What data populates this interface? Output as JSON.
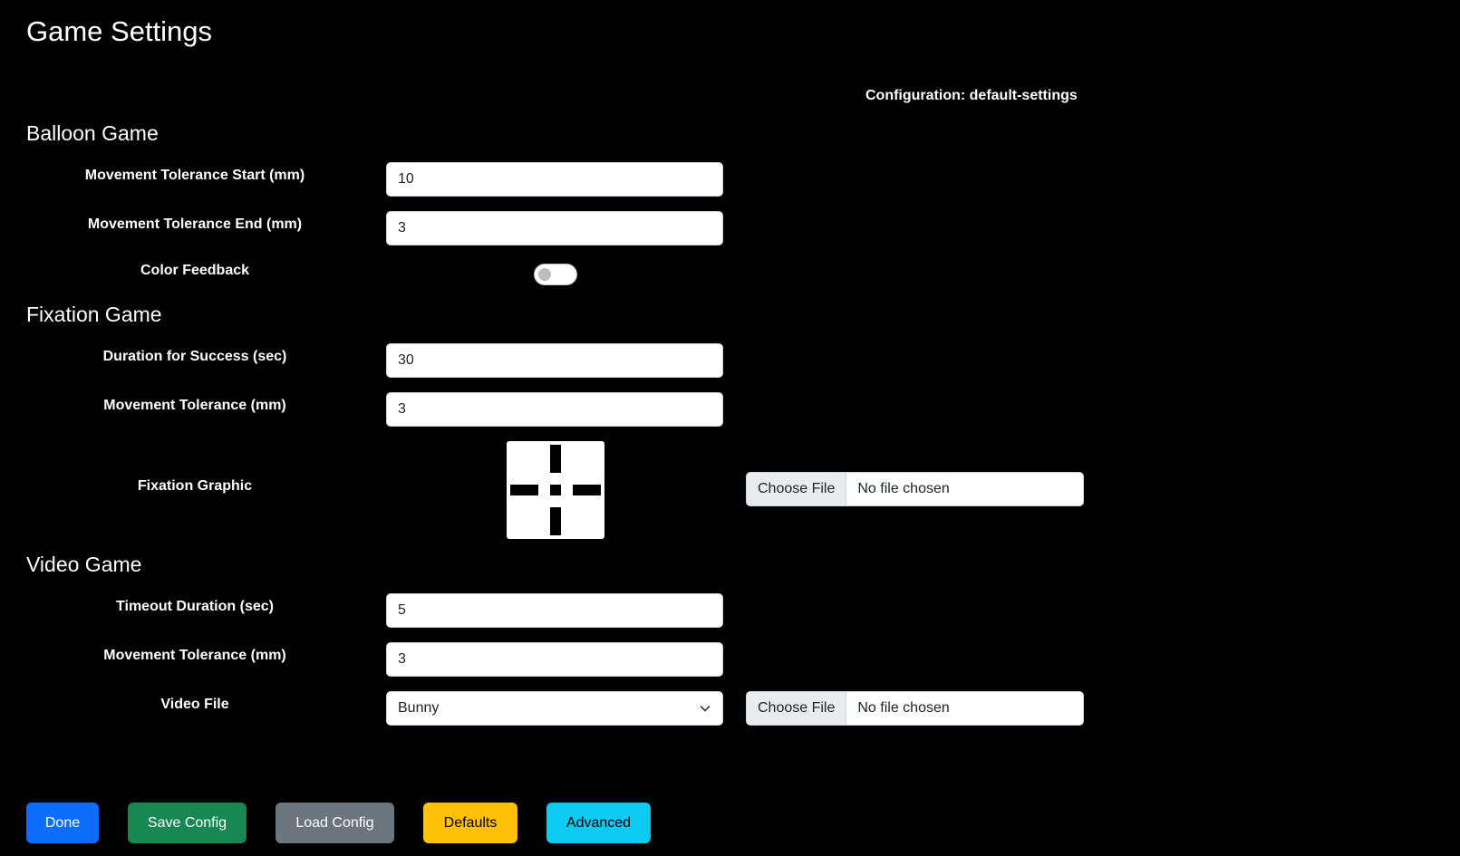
{
  "page": {
    "title": "Game Settings",
    "configuration_label": "Configuration: default-settings"
  },
  "balloon_game": {
    "title": "Balloon Game",
    "movement_tolerance_start": {
      "label": "Movement Tolerance Start (mm)",
      "value": "10"
    },
    "movement_tolerance_end": {
      "label": "Movement Tolerance End (mm)",
      "value": "3"
    },
    "color_feedback": {
      "label": "Color Feedback",
      "enabled": false
    }
  },
  "fixation_game": {
    "title": "Fixation Game",
    "duration_for_success": {
      "label": "Duration for Success (sec)",
      "value": "30"
    },
    "movement_tolerance": {
      "label": "Movement Tolerance (mm)",
      "value": "3"
    },
    "fixation_graphic": {
      "label": "Fixation Graphic",
      "icon": "crosshair-graphic-icon",
      "file_button": "Choose File",
      "file_status": "No file chosen"
    }
  },
  "video_game": {
    "title": "Video Game",
    "timeout_duration": {
      "label": "Timeout Duration (sec)",
      "value": "5"
    },
    "movement_tolerance": {
      "label": "Movement Tolerance (mm)",
      "value": "3"
    },
    "video_file": {
      "label": "Video File",
      "selected": "Bunny",
      "file_button": "Choose File",
      "file_status": "No file chosen"
    }
  },
  "buttons": {
    "done": "Done",
    "save_config": "Save Config",
    "load_config": "Load Config",
    "defaults": "Defaults",
    "advanced": "Advanced"
  },
  "colors": {
    "background": "#000000",
    "primary": "#0d6efd",
    "success": "#198754",
    "secondary": "#6c757d",
    "warning": "#ffc107",
    "info": "#0dcaf0"
  }
}
